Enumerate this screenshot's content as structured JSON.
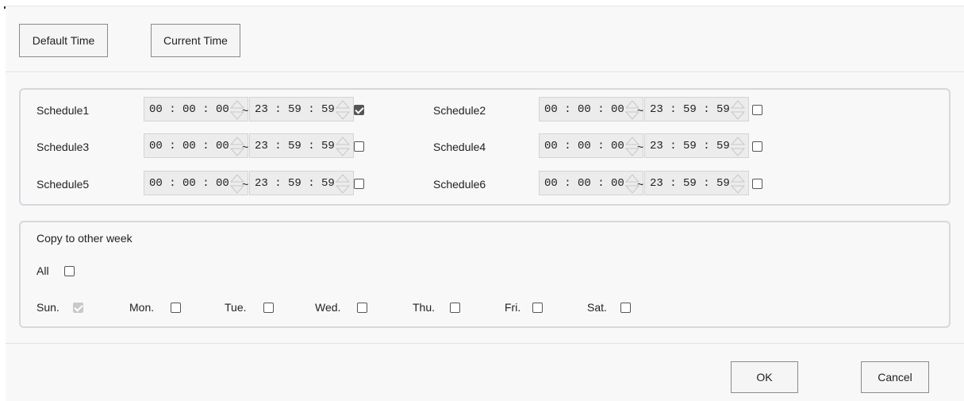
{
  "toolbar": {
    "default_time_label": "Default Time",
    "current_time_label": "Current Time"
  },
  "schedules": [
    {
      "label": "Schedule1",
      "start": "00 : 00 : 00",
      "end": "23 : 59 : 59",
      "enabled": true
    },
    {
      "label": "Schedule2",
      "start": "00 : 00 : 00",
      "end": "23 : 59 : 59",
      "enabled": false
    },
    {
      "label": "Schedule3",
      "start": "00 : 00 : 00",
      "end": "23 : 59 : 59",
      "enabled": false
    },
    {
      "label": "Schedule4",
      "start": "00 : 00 : 00",
      "end": "23 : 59 : 59",
      "enabled": false
    },
    {
      "label": "Schedule5",
      "start": "00 : 00 : 00",
      "end": "23 : 59 : 59",
      "enabled": false
    },
    {
      "label": "Schedule6",
      "start": "00 : 00 : 00",
      "end": "23 : 59 : 59",
      "enabled": false
    }
  ],
  "range_separator": "~",
  "copy": {
    "title": "Copy to other week",
    "all_label": "All",
    "days": [
      {
        "label": "Sun.",
        "checked": true,
        "disabled": true
      },
      {
        "label": "Mon.",
        "checked": false,
        "disabled": false
      },
      {
        "label": "Tue.",
        "checked": false,
        "disabled": false
      },
      {
        "label": "Wed.",
        "checked": false,
        "disabled": false
      },
      {
        "label": "Thu.",
        "checked": false,
        "disabled": false
      },
      {
        "label": "Fri.",
        "checked": false,
        "disabled": false
      },
      {
        "label": "Sat.",
        "checked": false,
        "disabled": false
      }
    ]
  },
  "footer": {
    "ok_label": "OK",
    "cancel_label": "Cancel"
  },
  "colors": {
    "panel_border": "#d6d8de",
    "checkbox_checked": "#555555",
    "checkbox_disabled": "#c9c9c9"
  }
}
